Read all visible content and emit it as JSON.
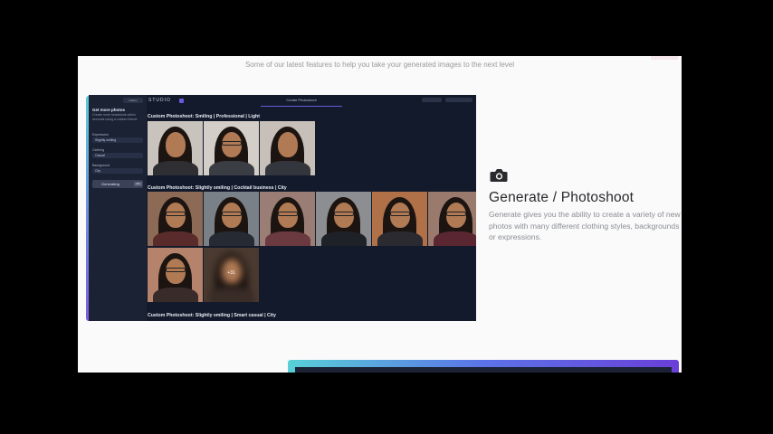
{
  "page": {
    "tagline": "Some of our latest features to help you take your generated images to the next level"
  },
  "app": {
    "logo": "STUDIO",
    "active_tab": "Create Photoshoot",
    "sidebar": {
      "top_button": "Gallery",
      "title": "Get more photos",
      "description": "Create more headshots within seconds using a custom theme",
      "expression_label": "Expression",
      "expression_value": "Slightly smiling",
      "clothing_label": "Clothing",
      "clothing_value": "Casual",
      "background_label": "Background",
      "background_value": "City",
      "generate_button": "Generating",
      "badge": "2/4"
    },
    "sections": [
      {
        "title": "Custom Photoshoot: Smiling | Professional | Light"
      },
      {
        "title": "Custom Photoshoot: Slightly smiling | Cocktail business | City"
      },
      {
        "title": "Custom Photoshoot: Slightly smiling | Smart casual | City"
      }
    ],
    "blurred_count": "+31"
  },
  "feature": {
    "icon": "camera-icon",
    "title": "Generate / Photoshoot",
    "description": "Generate gives you the ability to create a variety of new photos with many different clothing styles, backgrounds or expressions."
  }
}
